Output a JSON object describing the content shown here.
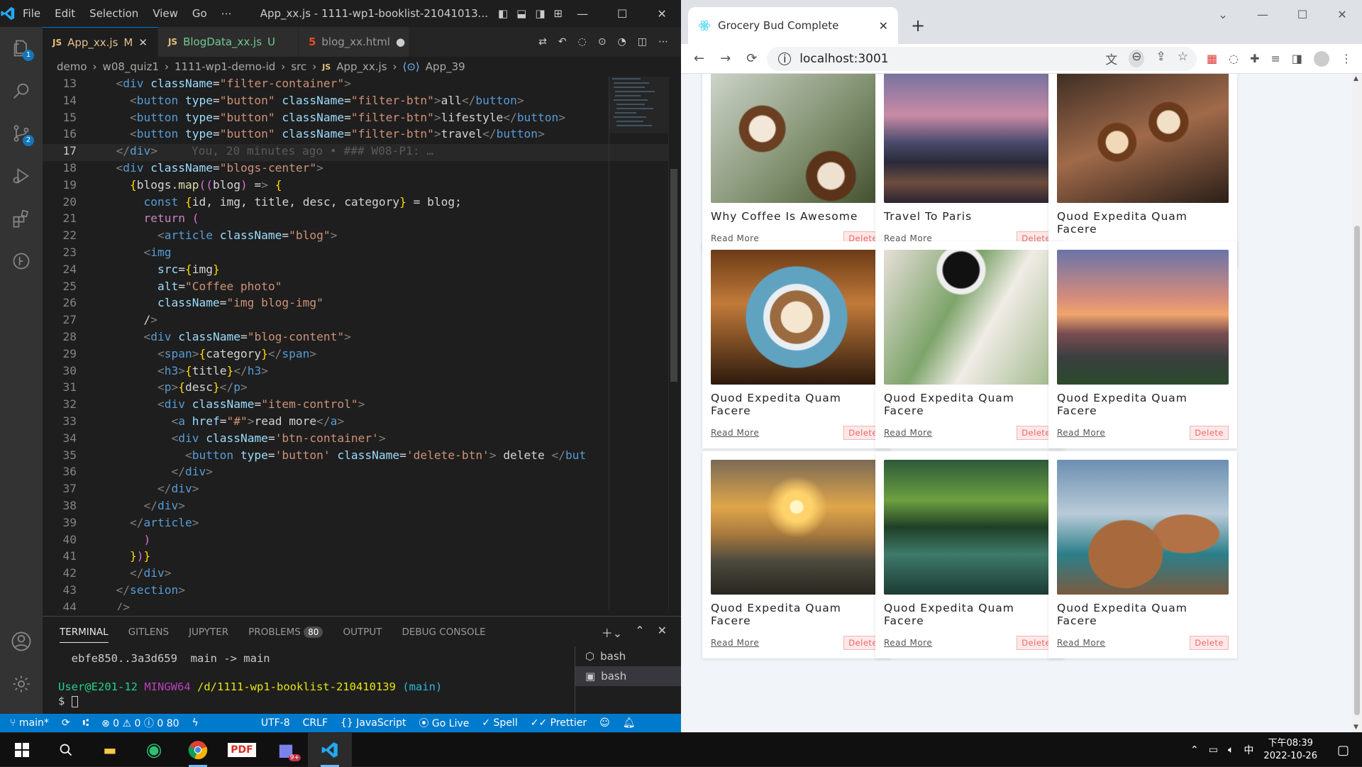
{
  "vscode": {
    "menu": [
      "File",
      "Edit",
      "Selection",
      "View",
      "Go",
      "⋯"
    ],
    "window_title": "App_xx.js - 1111-wp1-booklist-21041013...",
    "tabs": [
      {
        "name": "App_xx.js",
        "status": "M",
        "type": "js"
      },
      {
        "name": "BlogData_xx.js",
        "status": "U",
        "type": "js"
      },
      {
        "name": "blog_xx.html",
        "status": "●",
        "type": "html"
      }
    ],
    "breadcrumb": [
      "demo",
      "w08_quiz1",
      "1111-wp1-demo-id",
      "src",
      "App_xx.js",
      "App_39"
    ],
    "activity_badges": {
      "explorer": "1",
      "scm": "2"
    },
    "line_numbers": [
      "13",
      "14",
      "15",
      "16",
      "17",
      "18",
      "19",
      "20",
      "21",
      "22",
      "23",
      "24",
      "25",
      "26",
      "27",
      "28",
      "29",
      "30",
      "31",
      "32",
      "33",
      "34",
      "35",
      "36",
      "37",
      "38",
      "39",
      "40",
      "41",
      "42",
      "43",
      "44"
    ],
    "code_lines": [
      "  <div className=\"filter-container\">",
      "    <button type=\"button\" className=\"filter-btn\">all</button>",
      "    <button type=\"button\" className=\"filter-btn\">lifestyle</button>",
      "    <button type=\"button\" className=\"filter-btn\">travel</button>",
      "  </div>",
      "  <div className=\"blogs-center\">",
      "    {blogs.map((blog) => {",
      "      const {id, img, title, desc, category} = blog;",
      "      return (",
      "        <article className=\"blog\">",
      "      <img",
      "        src={img}",
      "        alt=\"Coffee photo\"",
      "        className=\"img blog-img\"",
      "      />",
      "      <div className=\"blog-content\">",
      "        <span>{category}</span>",
      "        <h3>{title}</h3>",
      "        <p>{desc}</p>",
      "        <div className=\"item-control\">",
      "          <a href=\"#\">read more</a>",
      "          <div className='btn-container'>",
      "            <button type='button' className='delete-btn'> delete </but",
      "          </div>",
      "        </div>",
      "      </div>",
      "    </article>",
      "      )",
      "    })}",
      "    </div>",
      "  </section>",
      "  </>"
    ],
    "blame": "You, 20 minutes ago • ### W08-P1: …",
    "panel_tabs": [
      "TERMINAL",
      "GITLENS",
      "JUPYTER",
      "PROBLEMS",
      "OUTPUT",
      "DEBUG CONSOLE"
    ],
    "problems_count": "80",
    "terminal": [
      "  ebfe850..3a3d659  main -> main",
      "",
      "User@E201-12 MINGW64 /d/1111-wp1-booklist-210410139 (main)",
      "$ "
    ],
    "terminal_user": "User@E201-12",
    "terminal_env": "MINGW64",
    "terminal_path": "/d/1111-wp1-booklist-210410139",
    "terminal_branch": "(main)",
    "shells": [
      "bash",
      "bash"
    ],
    "status": {
      "branch": "main*",
      "errors": "0",
      "warnings": "0",
      "infos": "0",
      "count": "80",
      "encoding": "UTF-8",
      "eol": "CRLF",
      "language": "JavaScript",
      "golive": "Go Live",
      "spell": "Spell",
      "prettier": "Prettier"
    }
  },
  "browser": {
    "tab_title": "Grocery Bud Complete",
    "url": "localhost:3001",
    "cards": [
      {
        "title": "Why Coffee Is Awesome",
        "read": "Read More",
        "del": "Delete",
        "img": "coffee-latte-art"
      },
      {
        "title": "Travel To Paris",
        "read": "Read More",
        "del": "Delete",
        "img": "paris-bridge-night"
      },
      {
        "title": "Quod Expedita Quam Facere",
        "read": "Read More",
        "del": "Delete",
        "img": "coffee-cups-hands"
      },
      {
        "title": "Quod Expedita Quam Facere",
        "read": "Read More",
        "del": "Delete",
        "img": "coffee-cup-blue"
      },
      {
        "title": "Quod Expedita Quam Facere",
        "read": "Read More",
        "del": "Delete",
        "img": "coffee-leaves-note"
      },
      {
        "title": "Quod Expedita Quam Facere",
        "read": "Read More",
        "del": "Delete",
        "img": "taipei-skyline"
      },
      {
        "title": "Quod Expedita Quam Facere",
        "read": "Read More",
        "del": "Delete",
        "img": "sunset-mountains"
      },
      {
        "title": "Quod Expedita Quam Facere",
        "read": "Read More",
        "del": "Delete",
        "img": "green-river"
      },
      {
        "title": "Quod Expedita Quam Facere",
        "read": "Read More",
        "del": "Delete",
        "img": "rock-formation"
      }
    ]
  },
  "taskbar": {
    "time": "08:39",
    "ampm": "下午",
    "date": "2022-10-26",
    "ime": "中",
    "teams_badge": "9+"
  }
}
